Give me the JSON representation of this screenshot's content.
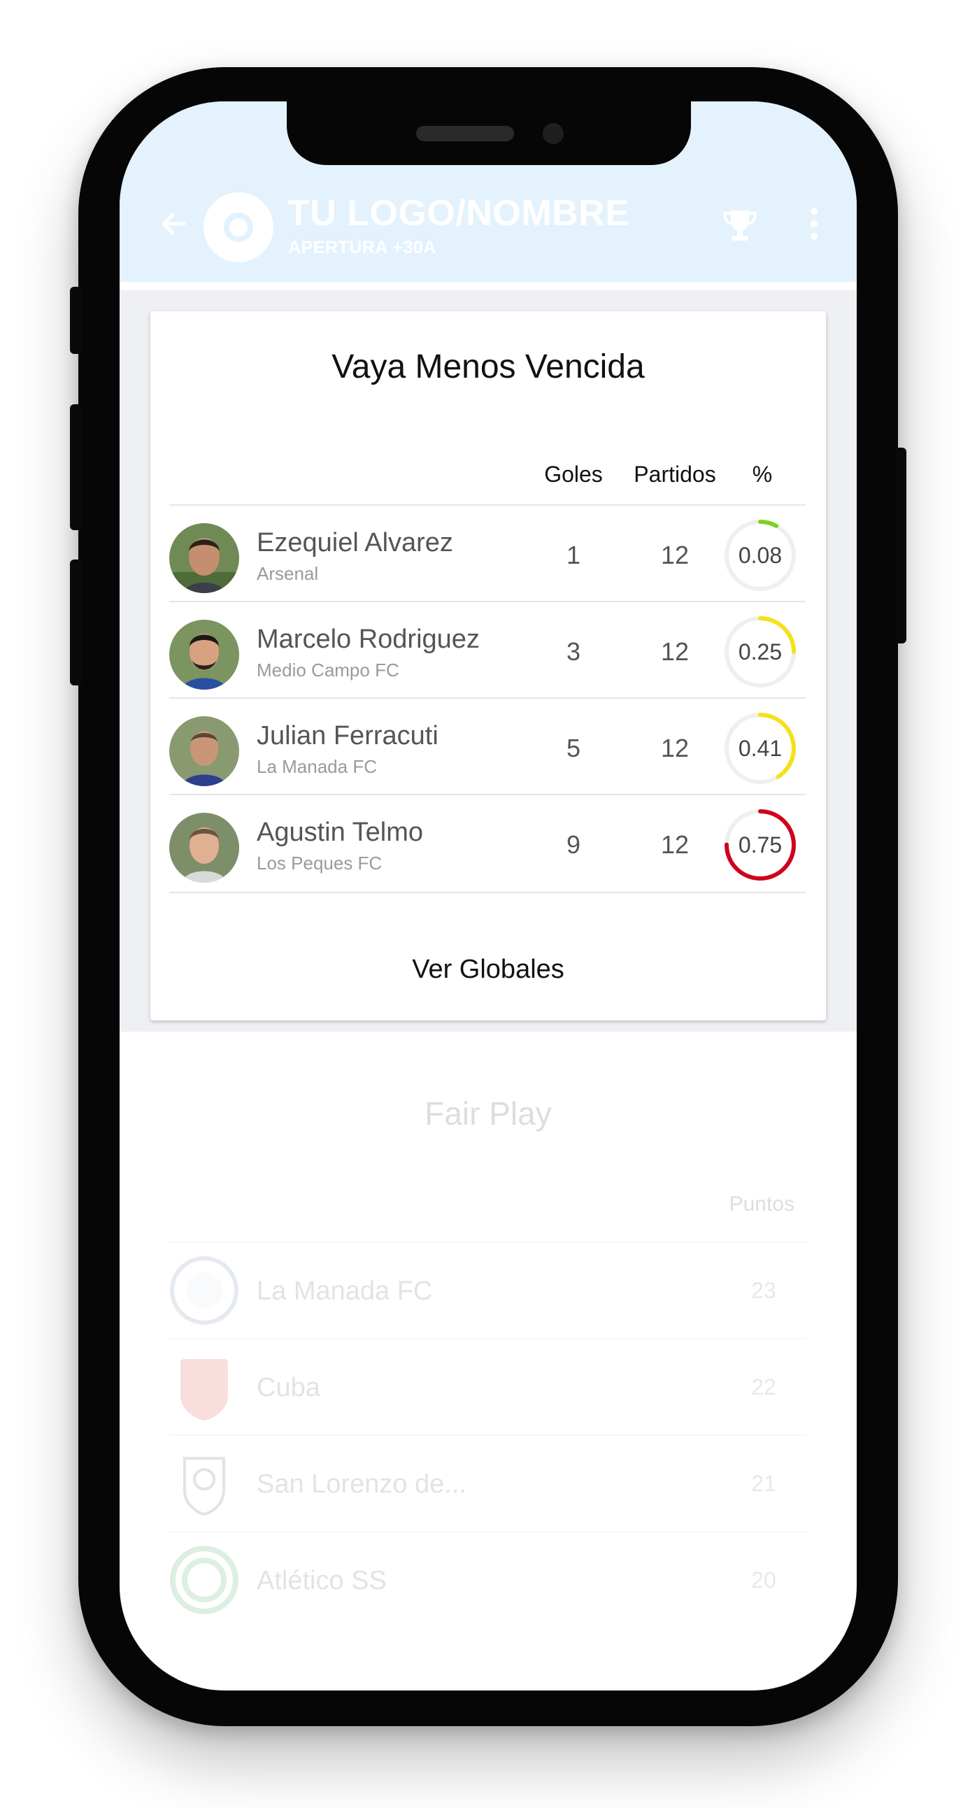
{
  "header": {
    "title": "TU LOGO/NOMBRE",
    "subtitle": "APERTURA +30A",
    "accent_color": "#e3f2fc",
    "icons": [
      "back-arrow-icon",
      "logo-icon",
      "trophy-icon",
      "more-vert-icon"
    ]
  },
  "card": {
    "title": "Vaya Menos Vencida",
    "columns": {
      "goals": "Goles",
      "matches": "Partidos",
      "pct": "%"
    },
    "players": [
      {
        "name": "Ezequiel Alvarez",
        "team": "Arsenal",
        "goals": "1",
        "matches": "12",
        "pct": "0.08",
        "ring_fraction": 0.08,
        "ring_color": "#7ed321"
      },
      {
        "name": "Marcelo Rodriguez",
        "team": "Medio Campo FC",
        "goals": "3",
        "matches": "12",
        "pct": "0.25",
        "ring_fraction": 0.25,
        "ring_color": "#f5e11b"
      },
      {
        "name": "Julian Ferracuti",
        "team": "La Manada FC",
        "goals": "5",
        "matches": "12",
        "pct": "0.41",
        "ring_fraction": 0.41,
        "ring_color": "#f5e11b"
      },
      {
        "name": "Agustin Telmo",
        "team": "Los Peques FC",
        "goals": "9",
        "matches": "12",
        "pct": "0.75",
        "ring_fraction": 0.75,
        "ring_color": "#d0021b"
      }
    ],
    "footer_link": "Ver Globales"
  },
  "fair_play": {
    "title": "Fair Play",
    "column": "Puntos",
    "teams": [
      {
        "name": "La Manada FC",
        "points": "23",
        "logo_color": "#5b7fa3"
      },
      {
        "name": "Cuba",
        "points": "22",
        "logo_color": "#e53935"
      },
      {
        "name": "San Lorenzo de...",
        "points": "21",
        "logo_color": "#555555"
      },
      {
        "name": "Atlético SS",
        "points": "20",
        "logo_color": "#2e9e4f"
      }
    ]
  }
}
